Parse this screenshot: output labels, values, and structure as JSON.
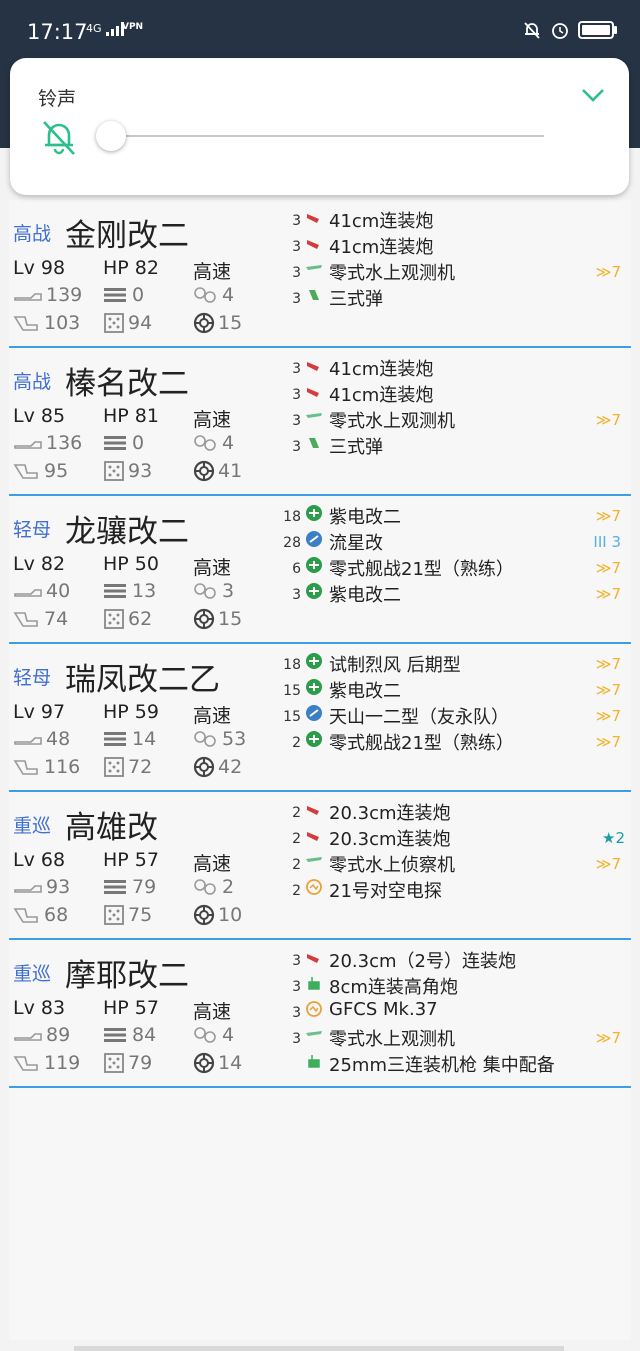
{
  "status_bar": {
    "time": "17:17",
    "network": "4G",
    "vpn": "VPN",
    "icons": [
      "bell-off-icon",
      "alarm-icon",
      "battery-icon"
    ]
  },
  "volume_panel": {
    "title": "铃声",
    "mute_icon": "bell-off-icon",
    "expand_icon": "chevron-down-icon",
    "level": 0,
    "accent": "#2bbf8a"
  },
  "colors": {
    "class_label": "#3f6fd0",
    "divider": "#3d9ee6",
    "improve": "#f2b329",
    "star": "#1a9e9e"
  },
  "ships": [
    {
      "class": "高战",
      "name": "金刚改二",
      "lv": "Lv 98",
      "hp": "HP 82",
      "speed": "高速",
      "fire": "139",
      "torpedo": "0",
      "range": "4",
      "aa": "103",
      "armor": "94",
      "luck": "15",
      "equips": [
        {
          "count": "3",
          "icon": "main-gun-red",
          "name": "41cm连装炮",
          "imp": ""
        },
        {
          "count": "3",
          "icon": "main-gun-red",
          "name": "41cm连装炮",
          "imp": ""
        },
        {
          "count": "3",
          "icon": "seaplane-green",
          "name": "零式水上观测机",
          "imp": "≫7"
        },
        {
          "count": "3",
          "icon": "shell-green",
          "name": "三式弹",
          "imp": ""
        }
      ]
    },
    {
      "class": "高战",
      "name": "榛名改二",
      "lv": "Lv 85",
      "hp": "HP 81",
      "speed": "高速",
      "fire": "136",
      "torpedo": "0",
      "range": "4",
      "aa": "95",
      "armor": "93",
      "luck": "41",
      "equips": [
        {
          "count": "3",
          "icon": "main-gun-red",
          "name": "41cm连装炮",
          "imp": ""
        },
        {
          "count": "3",
          "icon": "main-gun-red",
          "name": "41cm连装炮",
          "imp": ""
        },
        {
          "count": "3",
          "icon": "seaplane-green",
          "name": "零式水上观测机",
          "imp": "≫7"
        },
        {
          "count": "3",
          "icon": "shell-green",
          "name": "三式弹",
          "imp": ""
        }
      ]
    },
    {
      "class": "轻母",
      "name": "龙骧改二",
      "lv": "Lv 82",
      "hp": "HP 50",
      "speed": "高速",
      "fire": "40",
      "torpedo": "13",
      "range": "3",
      "aa": "74",
      "armor": "62",
      "luck": "15",
      "equips": [
        {
          "count": "18",
          "icon": "fighter-green",
          "name": "紫电改二",
          "imp": "≫7"
        },
        {
          "count": "28",
          "icon": "bomber-blue",
          "name": "流星改",
          "imp": "III 3"
        },
        {
          "count": "6",
          "icon": "fighter-green",
          "name": "零式舰战21型（熟练）",
          "imp": "≫7"
        },
        {
          "count": "3",
          "icon": "fighter-green",
          "name": "紫电改二",
          "imp": "≫7"
        }
      ]
    },
    {
      "class": "轻母",
      "name": "瑞凤改二乙",
      "lv": "Lv 97",
      "hp": "HP 59",
      "speed": "高速",
      "fire": "48",
      "torpedo": "14",
      "range": "53",
      "aa": "116",
      "armor": "72",
      "luck": "42",
      "equips": [
        {
          "count": "18",
          "icon": "fighter-green",
          "name": "试制烈风 后期型",
          "imp": "≫7"
        },
        {
          "count": "15",
          "icon": "fighter-green",
          "name": "紫电改二",
          "imp": "≫7"
        },
        {
          "count": "15",
          "icon": "bomber-blue",
          "name": "天山一二型（友永队）",
          "imp": "≫7"
        },
        {
          "count": "2",
          "icon": "fighter-green",
          "name": "零式舰战21型（熟练）",
          "imp": "≫7"
        }
      ]
    },
    {
      "class": "重巡",
      "name": "高雄改",
      "lv": "Lv 68",
      "hp": "HP 57",
      "speed": "高速",
      "fire": "93",
      "torpedo": "79",
      "range": "2",
      "aa": "68",
      "armor": "75",
      "luck": "10",
      "equips": [
        {
          "count": "2",
          "icon": "main-gun-red",
          "name": "20.3cm连装炮",
          "imp": ""
        },
        {
          "count": "2",
          "icon": "main-gun-red",
          "name": "20.3cm连装炮",
          "imp": "★2"
        },
        {
          "count": "2",
          "icon": "seaplane-green",
          "name": "零式水上侦察机",
          "imp": "≫7"
        },
        {
          "count": "2",
          "icon": "radar-orange",
          "name": "21号对空电探",
          "imp": ""
        }
      ]
    },
    {
      "class": "重巡",
      "name": "摩耶改二",
      "lv": "Lv 83",
      "hp": "HP 57",
      "speed": "高速",
      "fire": "89",
      "torpedo": "84",
      "range": "4",
      "aa": "119",
      "armor": "79",
      "luck": "14",
      "equips": [
        {
          "count": "3",
          "icon": "main-gun-red",
          "name": "20.3cm（2号）连装炮",
          "imp": ""
        },
        {
          "count": "3",
          "icon": "aa-gun-green",
          "name": "8cm连装高角炮",
          "imp": ""
        },
        {
          "count": "3",
          "icon": "radar-orange",
          "name": "GFCS Mk.37",
          "imp": ""
        },
        {
          "count": "3",
          "icon": "seaplane-green",
          "name": "零式水上观测机",
          "imp": "≫7"
        },
        {
          "count": "",
          "icon": "aa-gun-green",
          "name": "25mm三连装机枪 集中配备",
          "imp": ""
        }
      ]
    }
  ]
}
